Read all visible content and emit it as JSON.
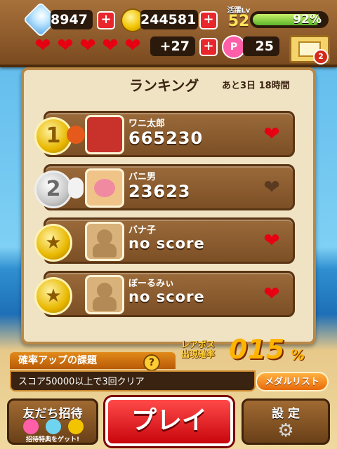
{
  "hud": {
    "gems": "8947",
    "coins": "244581",
    "level_label": "活躍Lv",
    "level": "52",
    "level_percent": "92%",
    "level_fill_fraction": 0.92,
    "hearts_extra": "+27",
    "points": "25",
    "mail_badge": "2",
    "plus_symbol": "+",
    "points_icon_letter": "P"
  },
  "ranking": {
    "title": "ランキング",
    "remaining": "あと3日 18時間",
    "rows": [
      {
        "rank": "1",
        "name": "ワニ太郎",
        "score": "665230"
      },
      {
        "rank": "2",
        "name": "バニ男",
        "score": "23623"
      },
      {
        "rank": "",
        "name": "バナ子",
        "score": "no score"
      },
      {
        "rank": "",
        "name": "ぼーるみぃ",
        "score": "no score"
      }
    ]
  },
  "rare_boss": {
    "label_line1": "レアボス",
    "label_line2": "出現確率",
    "value": "015",
    "unit": "%"
  },
  "mission": {
    "title": "確率アップの課題",
    "help": "?",
    "text": "スコア50000以上で3回クリア",
    "medal_list": "メダルリスト"
  },
  "buttons": {
    "invite": "友だち招待",
    "invite_sub": "招待特典をゲット!",
    "play": "プレイ",
    "settings": "設 定"
  },
  "colors": {
    "accent_orange": "#f08a1a",
    "play_red": "#e0161d",
    "wood": "#8a5a2b"
  }
}
